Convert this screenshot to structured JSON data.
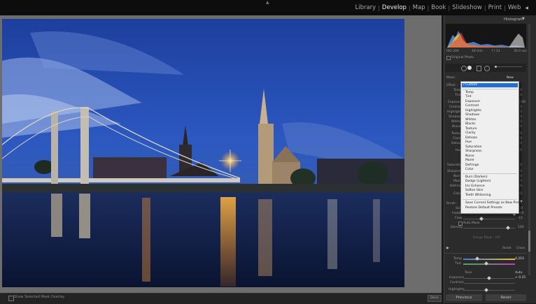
{
  "nav": {
    "modules": [
      "Library",
      "Develop",
      "Map",
      "Book",
      "Slideshow",
      "Print",
      "Web"
    ],
    "active": "Develop"
  },
  "panel": {
    "histogram_title": "Histogram",
    "original_photo": "Original Photo",
    "hist_info": [
      "ISO 200",
      "18 mm",
      "f / 11",
      "30.0 sec"
    ],
    "mask_new": "New",
    "mask_label": "Mask :",
    "effect_label": "Effect :",
    "left_labels": [
      "Temp",
      "Tint",
      "Exposure",
      "Contrast",
      "Highlights",
      "Shadows",
      "Whites",
      "Blacks",
      "Texture",
      "Clarity",
      "Dehaze",
      "Hue",
      "Saturation",
      "Sharpness",
      "Noise",
      "Moire",
      "Defringe",
      "Color"
    ],
    "brush_label": "Brush :",
    "size_label": "Size",
    "feather_label": "Feather",
    "flow_label": "Flow",
    "auto_mask": "Auto Mask",
    "density_label": "Density",
    "range_mask": "Range Mask : Off",
    "reset_small": "Reset",
    "close_small": "Close",
    "wb_temp": "Temp",
    "wb_tint": "Tint",
    "temp_value": "4,203",
    "tone_label": "Tone",
    "auto_label": "Auto",
    "exposure_label": "Exposure",
    "exposure_value": "+ 0.25",
    "contrast_label": "Contrast",
    "highlights_label": "Highlights",
    "brush_values": [
      "6.0",
      "100",
      "43"
    ],
    "density_value": "100",
    "right_values": [
      "0",
      "0",
      "0.00",
      "0",
      "0",
      "0",
      "0",
      "0",
      "0",
      "0",
      "0",
      "0",
      "0",
      "0",
      "0",
      "0",
      "0",
      "0"
    ]
  },
  "dropdown": {
    "selected": "Custom",
    "items": [
      "Temp",
      "Tint",
      "Exposure",
      "Contrast",
      "Highlights",
      "Shadows",
      "Whites",
      "Blacks",
      "Texture",
      "Clarity",
      "Dehaze",
      "Hue",
      "Saturation",
      "Sharpness",
      "Noise",
      "Moiré",
      "Defringe",
      "Color"
    ],
    "presets": [
      "Burn (Darken)",
      "Dodge (Lighten)",
      "Iris Enhance",
      "Soften Skin",
      "Teeth Whitening"
    ],
    "actions": [
      "Save Current Settings as New Preset...",
      "Restore Default Presets"
    ]
  },
  "bottom": {
    "mask_overlay": "Show Selected Mask Overlay",
    "done": "Done",
    "previous": "Previous",
    "reset": "Reset"
  },
  "colors": {
    "accent_blue": "#1f6fd6",
    "panel_bg": "#2b2b2b"
  }
}
